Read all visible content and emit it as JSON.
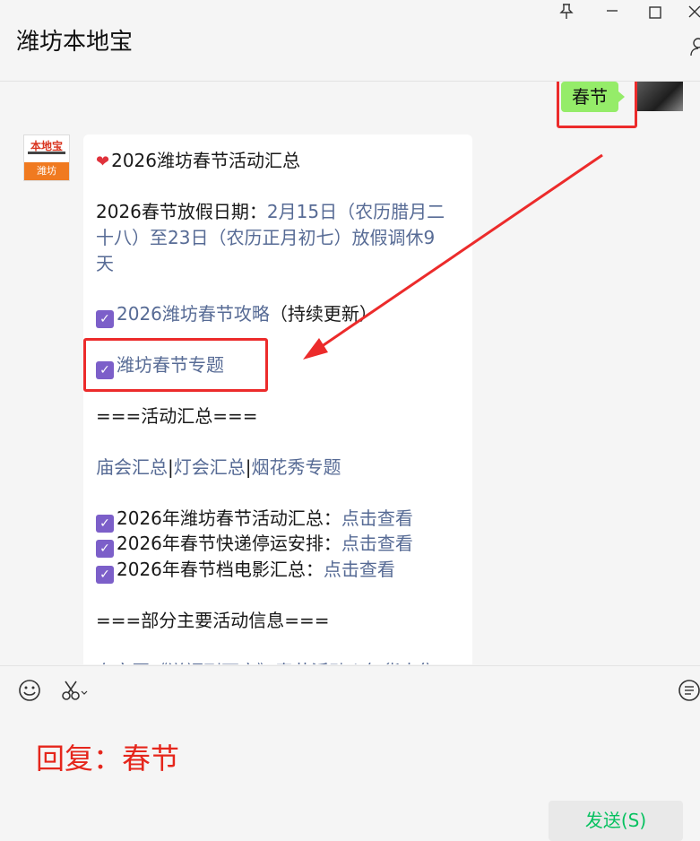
{
  "window": {
    "title": "潍坊本地宝",
    "pin_icon": "📌",
    "minimize_icon": "—",
    "maximize_icon": "☐",
    "close_icon": "✕"
  },
  "chat": {
    "user_message": "春节",
    "sender_logo": {
      "top_text": "本地宝",
      "bottom_text": "潍坊"
    },
    "card": {
      "title": "2026潍坊春节活动汇总",
      "holiday_label": "2026春节放假日期：",
      "holiday_line1": "2月15日（农历腊月二",
      "holiday_line2": "十八）至23日（农历正月初七）放假调休9",
      "holiday_line3": "天",
      "guide_link": "2026潍坊春节攻略",
      "guide_suffix": "（持续更新）",
      "topic_link": "潍坊春节专题",
      "section1": "===活动汇总===",
      "links_row": [
        "庙会汇总",
        "|",
        "灯会汇总",
        "|",
        "烟花秀专题"
      ],
      "items": [
        {
          "text": "2026年潍坊春节活动汇总：",
          "link": "点击查看"
        },
        {
          "text": "2026年春节快递停运安排：",
          "link": "点击查看"
        },
        {
          "text": "2026年春节档电影汇总：",
          "link": "点击查看"
        }
      ],
      "section2": "===部分主要活动信息===",
      "partial_line": "奎文区《送福到万家》春节活动 | 年货大集"
    }
  },
  "input": {
    "reply_text": "回复：春节",
    "send_label": "发送(S)"
  },
  "colors": {
    "accent_red": "#ec2b2b",
    "link": "#576b95",
    "bubble_green": "#95ec69",
    "check_purple": "#7c5fc9"
  }
}
